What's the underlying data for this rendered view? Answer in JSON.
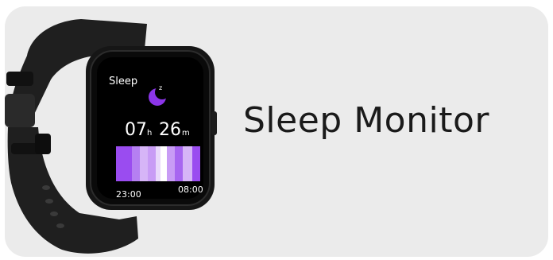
{
  "feature": {
    "title": "Sleep Monitor"
  },
  "watch": {
    "screen_title": "Sleep",
    "hours": "07",
    "hours_unit": "h",
    "minutes": "26",
    "minutes_unit": "m",
    "start_time": "23:00",
    "end_time": "08:00",
    "moon_icon": "moon-sleep-icon"
  },
  "colors": {
    "card_background": "#ebebeb",
    "watch_body": "#161616",
    "accent_purple": "#8b35e8",
    "title_text": "#1a1a1a"
  }
}
